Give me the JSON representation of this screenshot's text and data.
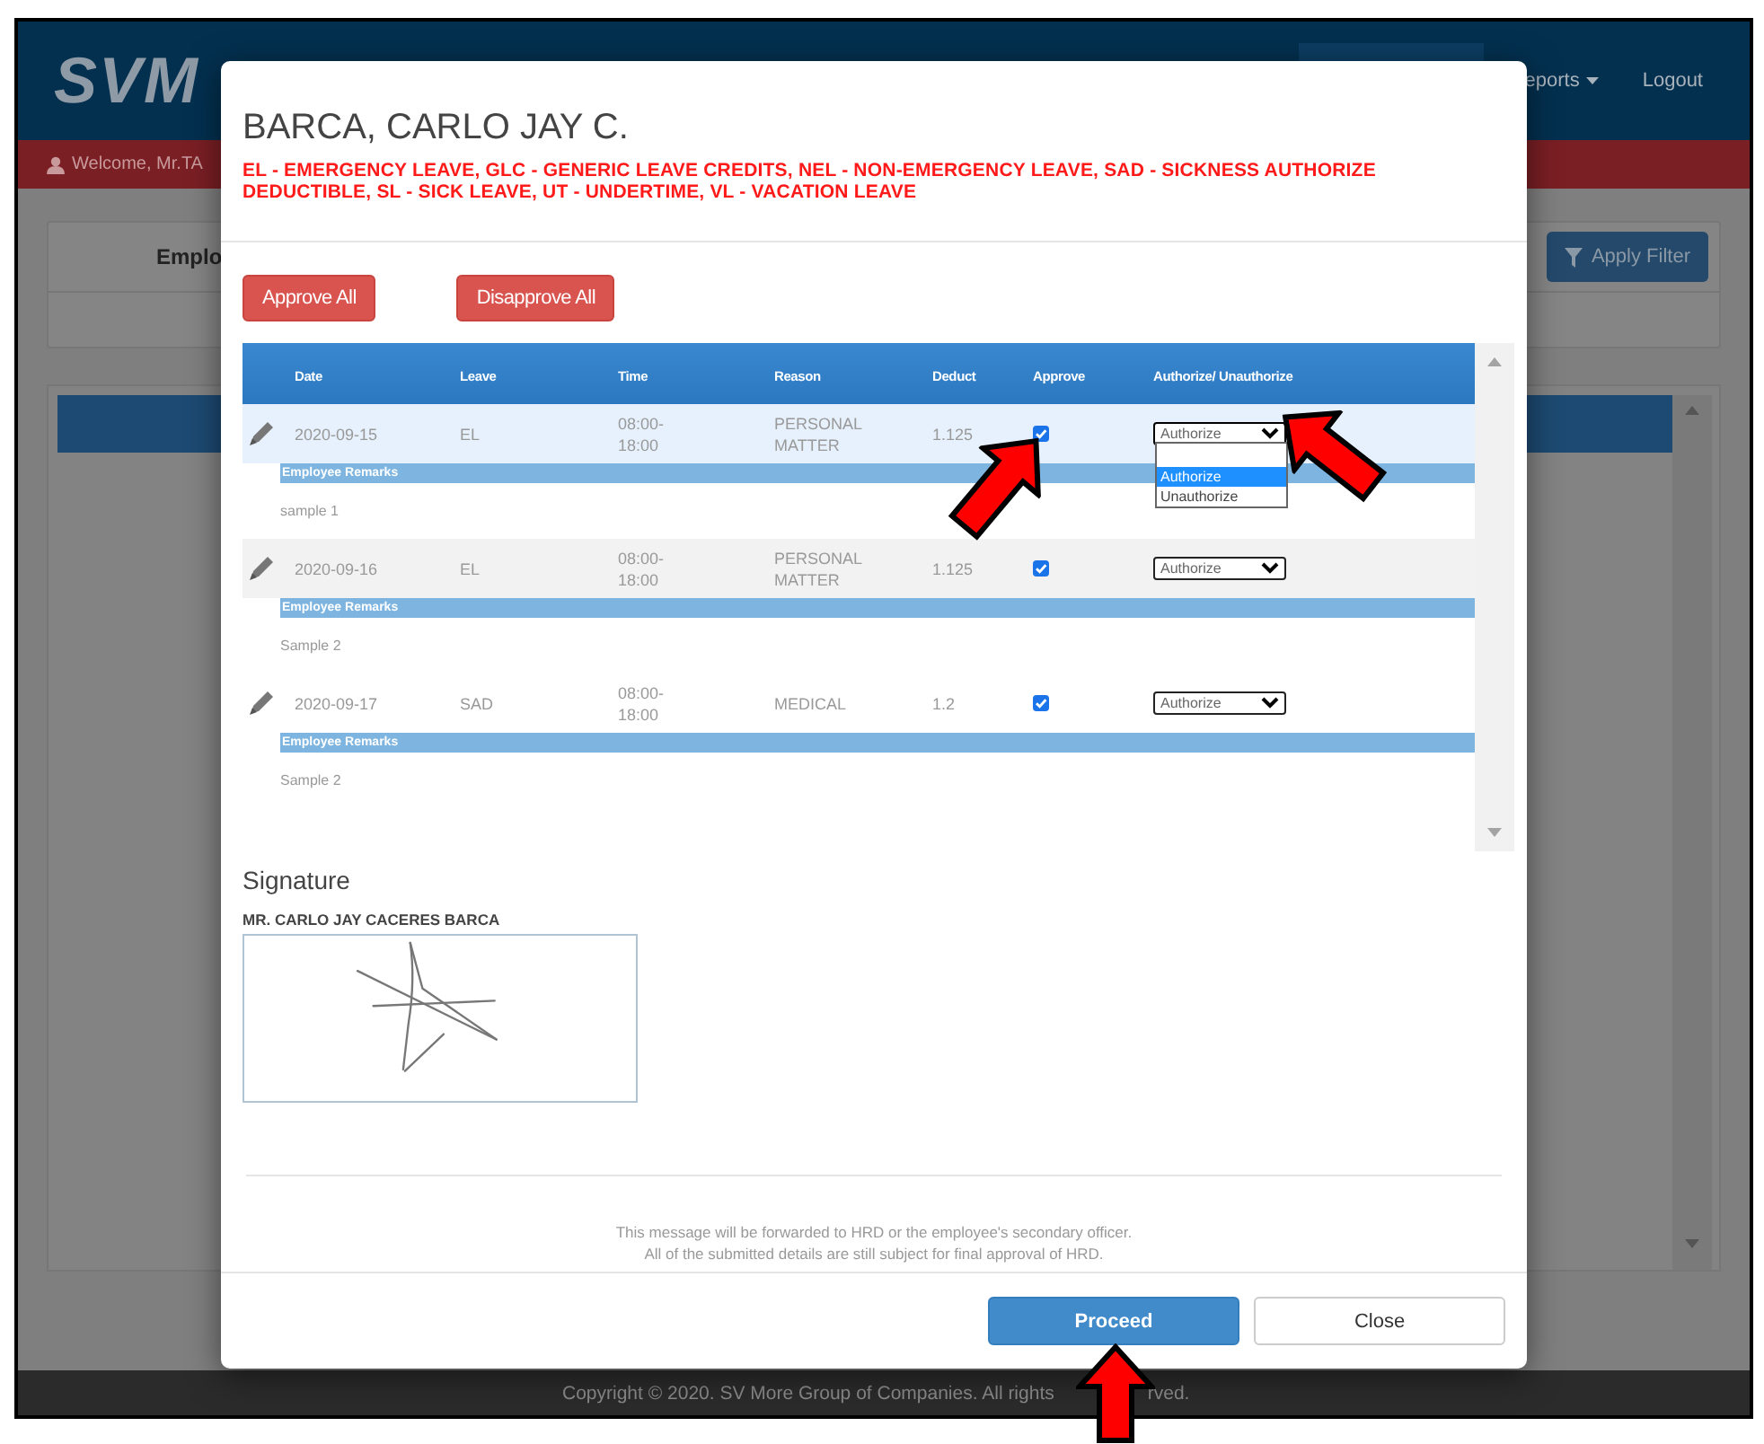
{
  "app": {
    "logo": "SVM",
    "nav": [
      {
        "label": "eports",
        "caret": true
      },
      {
        "label": "Logout",
        "caret": false
      }
    ],
    "welcome": "Welcome, Mr.TA",
    "filter_card": {
      "label": "Emplo",
      "button": "Apply Filter"
    },
    "footer": {
      "copyright": "Copyright © 2020. SV More Group of Companies. All rights",
      "copyright_tail": "rved."
    }
  },
  "modal": {
    "title": "BARCA, CARLO JAY C.",
    "legend": "EL - EMERGENCY LEAVE, GLC - GENERIC LEAVE CREDITS, NEL - NON-EMERGENCY LEAVE, SAD - SICKNESS AUTHORIZE DEDUCTIBLE, SL - SICK LEAVE, UT - UNDERTIME, VL - VACATION LEAVE",
    "actions": [
      "Approve All",
      "Disapprove All"
    ],
    "table": {
      "columns": [
        "Date",
        "Leave",
        "Time",
        "Reason",
        "Deduct",
        "Approve",
        "Authorize/ Unauthorize"
      ],
      "rows": [
        {
          "date": "2020-09-15",
          "leave": "EL",
          "time": "08:00-18:00",
          "reason": "PERSONAL MATTER",
          "deduct": "1.125",
          "approve": true,
          "authorize": "Authorize",
          "selected": true,
          "expanded": true,
          "options": [
            {
              "label": "Authorize",
              "selected": true
            },
            {
              "label": "Unauthorize",
              "selected": false
            }
          ],
          "remarks_label": "Employee Remarks",
          "remark": "sample 1"
        },
        {
          "date": "2020-09-16",
          "leave": "EL",
          "time": "08:00-18:00",
          "reason": "PERSONAL MATTER",
          "deduct": "1.125",
          "approve": true,
          "authorize": "Authorize",
          "selected": false,
          "expanded": false,
          "remarks_label": "Employee Remarks",
          "remark": "Sample 2"
        },
        {
          "date": "2020-09-17",
          "leave": "SAD",
          "time": "08:00-18:00",
          "reason": "MEDICAL",
          "deduct": "1.2",
          "approve": true,
          "authorize": "Authorize",
          "selected": false,
          "expanded": false,
          "remarks_label": "Employee Remarks",
          "remark": "Sample 2"
        }
      ]
    },
    "signature": {
      "heading": "Signature",
      "name": "MR. CARLO JAY CACERES BARCA"
    },
    "notes": [
      "This message will be forwarded to HRD or the employee's secondary officer.",
      "All of the submitted details are still subject for final approval of HRD."
    ],
    "buttons": [
      {
        "label": "Proceed",
        "kind": "primary"
      },
      {
        "label": "Close",
        "kind": "default"
      }
    ]
  }
}
